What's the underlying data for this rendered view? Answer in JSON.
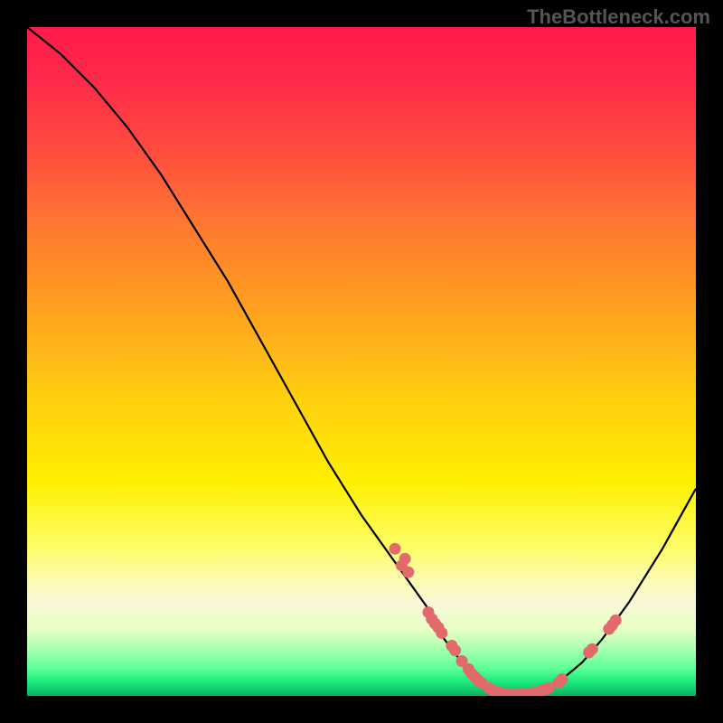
{
  "watermark": "TheBottleneck.com",
  "chart_data": {
    "type": "line",
    "title": "",
    "xlabel": "",
    "ylabel": "",
    "xlim": [
      0,
      100
    ],
    "ylim": [
      0,
      100
    ],
    "series": [
      {
        "name": "curve",
        "x": [
          0,
          5,
          10,
          15,
          20,
          25,
          30,
          35,
          40,
          45,
          50,
          55,
          60,
          62,
          65,
          68,
          70,
          72,
          75,
          78,
          80,
          83,
          86,
          90,
          95,
          100
        ],
        "y": [
          100,
          96,
          91,
          85,
          78,
          70,
          62,
          53,
          44,
          35,
          27,
          20,
          13,
          9,
          5,
          2,
          0.6,
          0.2,
          0.3,
          1,
          2.5,
          5,
          8.5,
          14,
          22,
          31
        ]
      }
    ],
    "markers": [
      {
        "x": 55.0,
        "y": 22.0
      },
      {
        "x": 56.0,
        "y": 19.5
      },
      {
        "x": 56.5,
        "y": 20.5
      },
      {
        "x": 57.0,
        "y": 18.5
      },
      {
        "x": 60.0,
        "y": 12.5
      },
      {
        "x": 60.5,
        "y": 11.5
      },
      {
        "x": 61.0,
        "y": 10.8
      },
      {
        "x": 61.5,
        "y": 10.2
      },
      {
        "x": 62.0,
        "y": 9.4
      },
      {
        "x": 63.5,
        "y": 7.5
      },
      {
        "x": 64.0,
        "y": 6.8
      },
      {
        "x": 65.0,
        "y": 5.2
      },
      {
        "x": 66.0,
        "y": 4.0
      },
      {
        "x": 66.5,
        "y": 3.3
      },
      {
        "x": 67.0,
        "y": 2.8
      },
      {
        "x": 67.5,
        "y": 2.3
      },
      {
        "x": 68.0,
        "y": 1.9
      },
      {
        "x": 69.0,
        "y": 1.2
      },
      {
        "x": 69.5,
        "y": 0.9
      },
      {
        "x": 70.0,
        "y": 0.6
      },
      {
        "x": 70.5,
        "y": 0.5
      },
      {
        "x": 71.0,
        "y": 0.4
      },
      {
        "x": 71.5,
        "y": 0.3
      },
      {
        "x": 72.0,
        "y": 0.2
      },
      {
        "x": 72.5,
        "y": 0.18
      },
      {
        "x": 73.0,
        "y": 0.15
      },
      {
        "x": 73.5,
        "y": 0.2
      },
      {
        "x": 74.0,
        "y": 0.22
      },
      {
        "x": 74.5,
        "y": 0.25
      },
      {
        "x": 75.0,
        "y": 0.3
      },
      {
        "x": 75.5,
        "y": 0.4
      },
      {
        "x": 76.0,
        "y": 0.5
      },
      {
        "x": 76.5,
        "y": 0.65
      },
      {
        "x": 77.0,
        "y": 0.85
      },
      {
        "x": 77.5,
        "y": 1.0
      },
      {
        "x": 78.0,
        "y": 1.2
      },
      {
        "x": 79.5,
        "y": 2.0
      },
      {
        "x": 80.0,
        "y": 2.5
      },
      {
        "x": 84.0,
        "y": 6.5
      },
      {
        "x": 84.5,
        "y": 7.0
      },
      {
        "x": 87.0,
        "y": 10.0
      },
      {
        "x": 87.5,
        "y": 10.6
      },
      {
        "x": 88.0,
        "y": 11.3
      }
    ],
    "background": {
      "type": "vertical-gradient",
      "stops": [
        {
          "pos": 0.0,
          "color": "#ff1a4a"
        },
        {
          "pos": 0.3,
          "color": "#ff7a30"
        },
        {
          "pos": 0.55,
          "color": "#ffce10"
        },
        {
          "pos": 0.78,
          "color": "#fdfd6a"
        },
        {
          "pos": 0.92,
          "color": "#a8ffb0"
        },
        {
          "pos": 1.0,
          "color": "#0ab060"
        }
      ]
    }
  }
}
